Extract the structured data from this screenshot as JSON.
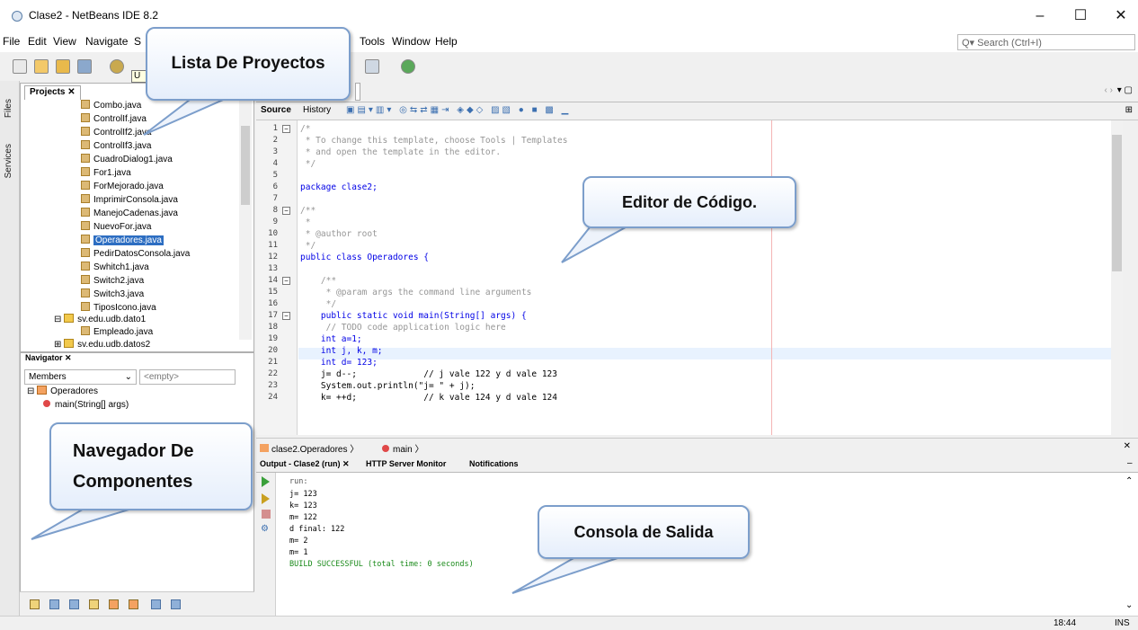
{
  "window": {
    "title": "Clase2 - NetBeans IDE 8.2",
    "minimize": "–",
    "maximize": "☐",
    "close": "✕"
  },
  "menu": [
    "File",
    "Edit",
    "View",
    "Navigate",
    "S",
    "Tools",
    "Window",
    "Help"
  ],
  "search": {
    "placeholder": "Search (Ctrl+I)"
  },
  "toolbar": {
    "tooltip": "U"
  },
  "leftstrip": {
    "files": "Files",
    "services": "Services"
  },
  "projects": {
    "tab": "Projects ✕",
    "files": [
      "Combo.java",
      "ControlIf.java",
      "ControlIf2.java",
      "ControlIf3.java",
      "CuadroDialog1.java",
      "For1.java",
      "ForMejorado.java",
      "ImprimirConsola.java",
      "ManejoCadenas.java",
      "NuevoFor.java",
      "Operadores.java",
      "PedirDatosConsola.java",
      "Swhitch1.java",
      "Switch2.java",
      "Switch3.java",
      "TiposIcono.java"
    ],
    "selected": "Operadores.java",
    "package1": "sv.edu.udb.dato1",
    "package1_file": "Empleado.java",
    "package2": "sv.edu.udb.datos2"
  },
  "navigator": {
    "tab": "Navigator ✕",
    "view": "Members",
    "filter": "<empty>",
    "class": "Operadores",
    "method": "main(String[] args)"
  },
  "editor": {
    "tab": "",
    "source_tab": "Source",
    "history_tab": "History",
    "line_numbers": [
      "1",
      "2",
      "3",
      "4",
      "5",
      "6",
      "7",
      "8",
      "9",
      "10",
      "11",
      "12",
      "13",
      "14",
      "15",
      "16",
      "17",
      "18",
      "19",
      "20",
      "21",
      "22",
      "23",
      "24"
    ],
    "lines": [
      "/*",
      " * To change this template, choose Tools | Templates",
      " * and open the template in the editor.",
      " */",
      "",
      "package clase2;",
      "",
      "/**",
      " *",
      " * @author root",
      " */",
      "public class Operadores {",
      "",
      "    /**",
      "     * @param args the command line arguments",
      "     */",
      "    public static void main(String[] args) {",
      "     // TODO code application logic here",
      "    int a=1;",
      "    int j, k, m;",
      "    int d= 123;",
      "    j= d--;             // j vale 122 y d vale 123",
      "    System.out.println(\"j= \" + j);",
      "    k= ++d;             // k vale 124 y d vale 124"
    ]
  },
  "breadcrumb": {
    "class": "clase2.Operadores",
    "method": "main",
    "close": "✕"
  },
  "output": {
    "tabs": [
      "Output - Clase2 (run) ✕",
      "HTTP Server Monitor",
      "Notifications"
    ],
    "lines": [
      "run:",
      "j= 123",
      "k= 123",
      "m= 122",
      "d final: 122",
      "m= 2",
      "m= 1",
      "BUILD SUCCESSFUL (total time: 0 seconds)"
    ]
  },
  "status": {
    "time": "18:44",
    "mode": "INS"
  },
  "callouts": {
    "projects": "Lista De Proyectos",
    "editor": "Editor de Código.",
    "navigator": "Navegador De Componentes",
    "console": "Consola de Salida"
  },
  "colors": {
    "callout_border": "#7c9ecb",
    "selection": "#2d6ec2",
    "keyword": "#0000e6",
    "comment": "#969696",
    "string": "#ce7b00"
  }
}
